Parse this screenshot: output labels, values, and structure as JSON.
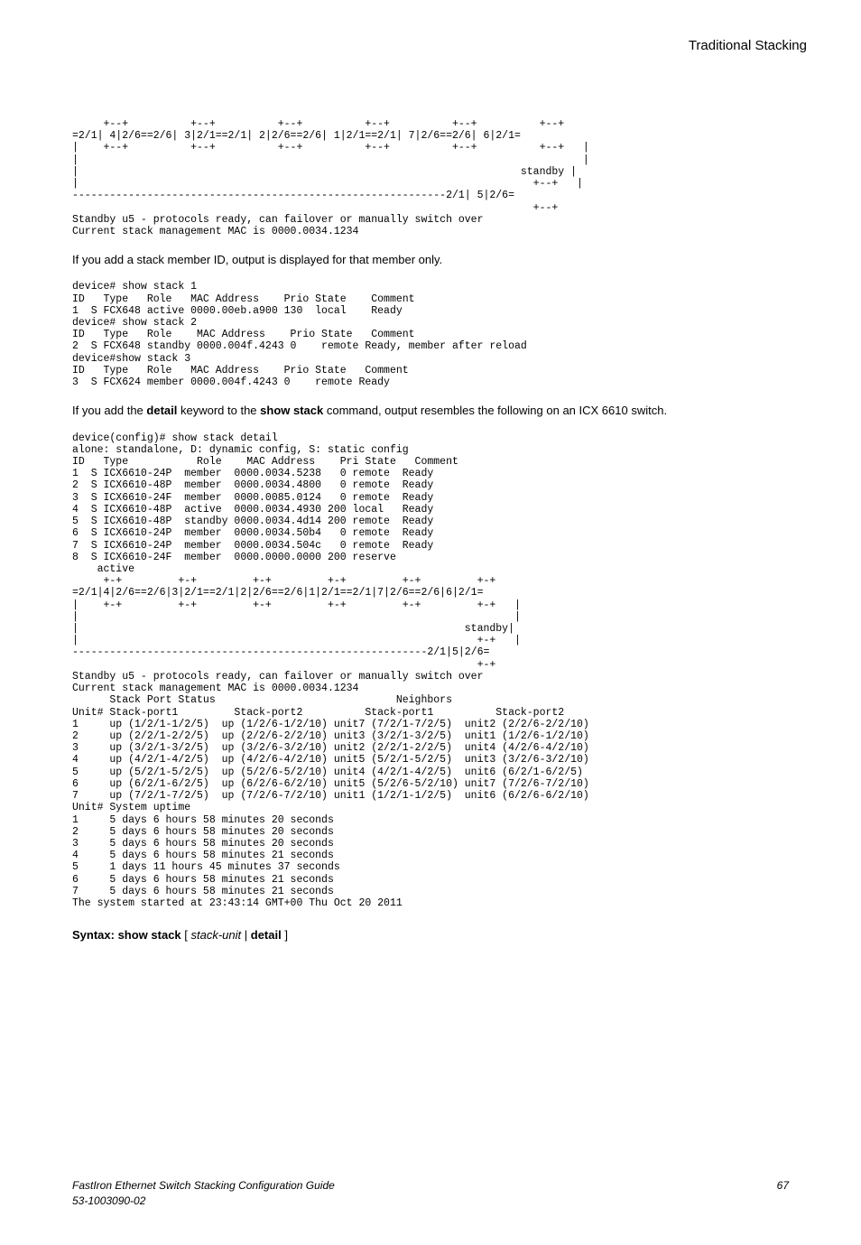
{
  "header": {
    "running_title": "Traditional Stacking"
  },
  "blocks": {
    "pre1": "     +--+          +--+          +--+          +--+          +--+          +--+\n=2/1| 4|2/6==2/6| 3|2/1==2/1| 2|2/6==2/6| 1|2/1==2/1| 7|2/6==2/6| 6|2/1=\n|    +--+          +--+          +--+          +--+          +--+          +--+   |\n|                                                                                 |\n|                                                                       standby |\n|                                                                         +--+   |\n------------------------------------------------------------2/1| 5|2/6=\n                                                                          +--+\nStandby u5 - protocols ready, can failover or manually switch over\nCurrent stack management MAC is 0000.0034.1234",
    "para1": "If you add a stack member ID, output is displayed for that member only.",
    "pre2": "device# show stack 1\nID   Type   Role   MAC Address    Prio State    Comment\n1  S FCX648 active 0000.00eb.a900 130  local    Ready\ndevice# show stack 2\nID   Type   Role    MAC Address    Prio State   Comment\n2  S FCX648 standby 0000.004f.4243 0    remote Ready, member after reload\ndevice#show stack 3\nID   Type   Role   MAC Address    Prio State   Comment\n3  S FCX624 member 0000.004f.4243 0    remote Ready",
    "para2_pre": "If you add the ",
    "para2_kw1": "detail",
    "para2_mid": " keyword to the ",
    "para2_kw2": "show stack",
    "para2_post": " command, output resembles the following on an ICX 6610 switch.",
    "pre3": "device(config)# show stack detail\nalone: standalone, D: dynamic config, S: static config\nID   Type           Role    MAC Address    Pri State   Comment\n1  S ICX6610-24P  member  0000.0034.5238   0 remote  Ready\n2  S ICX6610-48P  member  0000.0034.4800   0 remote  Ready\n3  S ICX6610-24F  member  0000.0085.0124   0 remote  Ready\n4  S ICX6610-48P  active  0000.0034.4930 200 local   Ready\n5  S ICX6610-48P  standby 0000.0034.4d14 200 remote  Ready\n6  S ICX6610-24P  member  0000.0034.50b4   0 remote  Ready\n7  S ICX6610-24P  member  0000.0034.504c   0 remote  Ready\n8  S ICX6610-24F  member  0000.0000.0000 200 reserve\n    active\n     +-+         +-+         +-+         +-+         +-+         +-+\n=2/1|4|2/6==2/6|3|2/1==2/1|2|2/6==2/6|1|2/1==2/1|7|2/6==2/6|6|2/1=\n|    +-+         +-+         +-+         +-+         +-+         +-+   |\n|                                                                      |\n|                                                              standby|\n|                                                                +-+   |\n---------------------------------------------------------2/1|5|2/6=\n                                                                 +-+\nStandby u5 - protocols ready, can failover or manually switch over\nCurrent stack management MAC is 0000.0034.1234\n      Stack Port Status                             Neighbors\nUnit# Stack-port1         Stack-port2          Stack-port1          Stack-port2\n1     up (1/2/1-1/2/5)  up (1/2/6-1/2/10) unit7 (7/2/1-7/2/5)  unit2 (2/2/6-2/2/10)\n2     up (2/2/1-2/2/5)  up (2/2/6-2/2/10) unit3 (3/2/1-3/2/5)  unit1 (1/2/6-1/2/10)\n3     up (3/2/1-3/2/5)  up (3/2/6-3/2/10) unit2 (2/2/1-2/2/5)  unit4 (4/2/6-4/2/10)\n4     up (4/2/1-4/2/5)  up (4/2/6-4/2/10) unit5 (5/2/1-5/2/5)  unit3 (3/2/6-3/2/10)\n5     up (5/2/1-5/2/5)  up (5/2/6-5/2/10) unit4 (4/2/1-4/2/5)  unit6 (6/2/1-6/2/5)\n6     up (6/2/1-6/2/5)  up (6/2/6-6/2/10) unit5 (5/2/6-5/2/10) unit7 (7/2/6-7/2/10)\n7     up (7/2/1-7/2/5)  up (7/2/6-7/2/10) unit1 (1/2/1-1/2/5)  unit6 (6/2/6-6/2/10)\nUnit# System uptime\n1     5 days 6 hours 58 minutes 20 seconds\n2     5 days 6 hours 58 minutes 20 seconds\n3     5 days 6 hours 58 minutes 20 seconds\n4     5 days 6 hours 58 minutes 21 seconds\n5     1 days 11 hours 45 minutes 37 seconds\n6     5 days 6 hours 58 minutes 21 seconds\n7     5 days 6 hours 58 minutes 21 seconds\nThe system started at 23:43:14 GMT+00 Thu Oct 20 2011",
    "syntax_label": "Syntax: show stack",
    "syntax_open": " [ ",
    "syntax_arg1": "stack-unit",
    "syntax_sep": " | ",
    "syntax_kw": "detail",
    "syntax_close": " ]"
  },
  "footer": {
    "left_line1": "FastIron Ethernet Switch Stacking Configuration Guide",
    "left_line2": "53-1003090-02",
    "page_number": "67"
  }
}
